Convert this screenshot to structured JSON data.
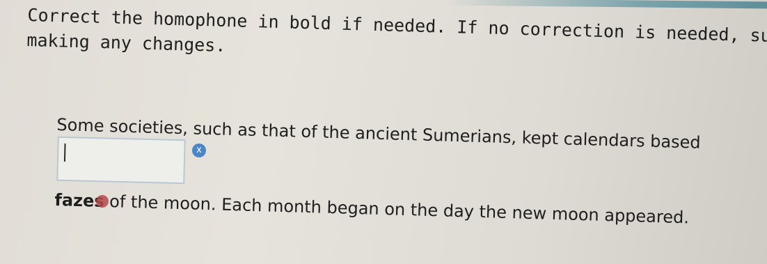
{
  "instructions": {
    "line1": "Correct the homophone in bold if needed. If no correction is needed, submit the",
    "line2": "making any changes."
  },
  "passage": {
    "part1": "Some societies, such as that of the ancient Sumerians, kept calendars based",
    "bold_word": "fazes",
    "part2": " of the moon. Each month began on the day the new moon appeared."
  },
  "answer_input": {
    "value": "",
    "placeholder": ""
  },
  "icons": {
    "clear": "close-icon",
    "clear_glyph": "x"
  },
  "colors": {
    "clear_icon": "#4a86c8",
    "input_border": "#b9c7d2"
  }
}
